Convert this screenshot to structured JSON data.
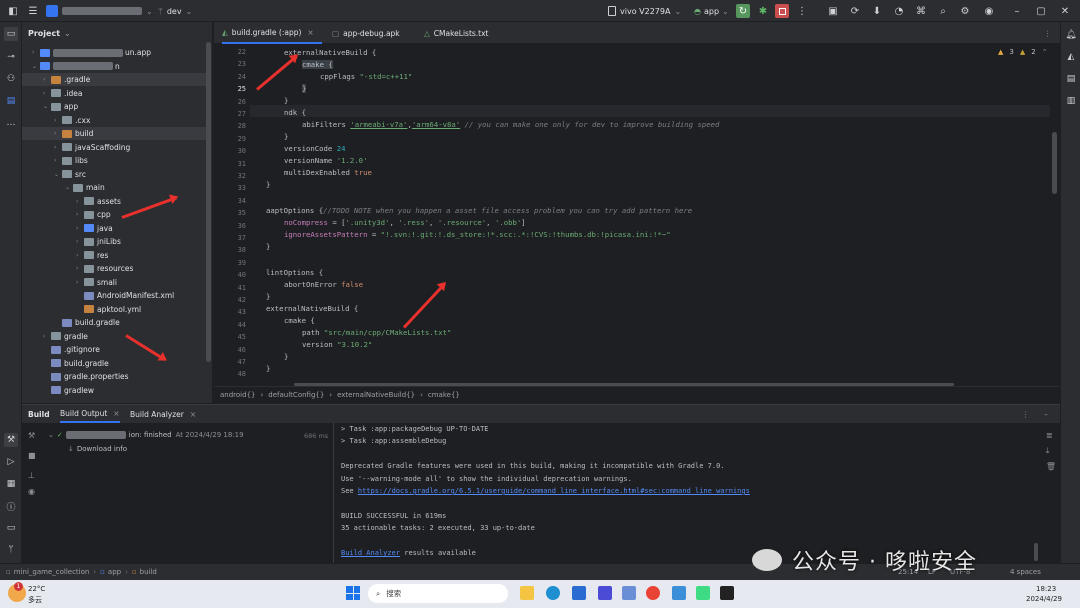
{
  "titlebar": {
    "branch": "dev",
    "device": "vivo V2279A",
    "run_config": "app"
  },
  "project_panel": {
    "header": "Project",
    "tree": [
      {
        "label": "un.app",
        "indent": 0,
        "icon": "foldb",
        "chev": "›"
      },
      {
        "label": "n",
        "indent": 0,
        "icon": "foldb",
        "chev": "⌄"
      },
      {
        "label": ".gradle",
        "indent": 1,
        "icon": "foldo",
        "chev": "›",
        "sel": true
      },
      {
        "label": ".idea",
        "indent": 1,
        "icon": "fold",
        "chev": "›"
      },
      {
        "label": "app",
        "indent": 1,
        "icon": "fold",
        "chev": "⌄"
      },
      {
        "label": ".cxx",
        "indent": 2,
        "icon": "fold",
        "chev": "›"
      },
      {
        "label": "build",
        "indent": 2,
        "icon": "foldo",
        "chev": "›",
        "sel": true
      },
      {
        "label": "javaScaffoding",
        "indent": 2,
        "icon": "fold",
        "chev": "›"
      },
      {
        "label": "libs",
        "indent": 2,
        "icon": "fold",
        "chev": "›"
      },
      {
        "label": "src",
        "indent": 2,
        "icon": "fold",
        "chev": "⌄"
      },
      {
        "label": "main",
        "indent": 3,
        "icon": "fold",
        "chev": "⌄"
      },
      {
        "label": "assets",
        "indent": 4,
        "icon": "fold",
        "chev": "›"
      },
      {
        "label": "cpp",
        "indent": 4,
        "icon": "fold",
        "chev": "›"
      },
      {
        "label": "java",
        "indent": 4,
        "icon": "foldb",
        "chev": "›"
      },
      {
        "label": "jniLibs",
        "indent": 4,
        "icon": "fold",
        "chev": "›"
      },
      {
        "label": "res",
        "indent": 4,
        "icon": "fold",
        "chev": "›"
      },
      {
        "label": "resources",
        "indent": 4,
        "icon": "fold",
        "chev": "›"
      },
      {
        "label": "smali",
        "indent": 4,
        "icon": "fold",
        "chev": "›"
      },
      {
        "label": "AndroidManifest.xml",
        "indent": 4,
        "icon": "filee",
        "chev": ""
      },
      {
        "label": "apktool.yml",
        "indent": 4,
        "icon": "foldo",
        "chev": ""
      },
      {
        "label": "build.gradle",
        "indent": 2,
        "icon": "filee",
        "chev": ""
      },
      {
        "label": "gradle",
        "indent": 1,
        "icon": "fold",
        "chev": "›"
      },
      {
        "label": ".gitignore",
        "indent": 1,
        "icon": "filee",
        "chev": ""
      },
      {
        "label": "build.gradle",
        "indent": 1,
        "icon": "filee",
        "chev": ""
      },
      {
        "label": "gradle.properties",
        "indent": 1,
        "icon": "filee",
        "chev": ""
      },
      {
        "label": "gradlew",
        "indent": 1,
        "icon": "filee",
        "chev": ""
      }
    ]
  },
  "editor": {
    "tabs": [
      "build.gradle (:app)",
      "app-debug.apk",
      "CMakeLists.txt"
    ],
    "inspections": {
      "warnings": "3",
      "weak": "2"
    },
    "line_numbers": [
      "22",
      "23",
      "24",
      "25",
      "26",
      "27",
      "28",
      "29",
      "30",
      "31",
      "32",
      "33",
      "34",
      "35",
      "36",
      "37",
      "38",
      "39",
      "40",
      "41",
      "42",
      "43",
      "44",
      "45",
      "46",
      "47",
      "48"
    ],
    "breadcrumb": [
      "android{}",
      "defaultConfig{}",
      "externalNativeBuild{}",
      "cmake{}"
    ]
  },
  "bottom": {
    "tabs": [
      "Build",
      "Build Output",
      "Build Analyzer"
    ],
    "tree": {
      "status": "ion: finished",
      "time": "At 2024/4/29 18:19",
      "duration": "686 ms",
      "child": "Download info"
    },
    "output": [
      "> Task :app:packageDebug UP-TO-DATE",
      "> Task :app:assembleDebug",
      "",
      "Deprecated Gradle features were used in this build, making it incompatible with Gradle 7.0.",
      "Use '--warning-mode all' to show the individual deprecation warnings.",
      "See ",
      "",
      "BUILD SUCCESSFUL in 619ms",
      "35 actionable tasks: 2 executed, 33 up-to-date",
      "",
      " results available"
    ],
    "output_link": "https://docs.gradle.org/6.5.1/userguide/command_line_interface.html#sec:command_line_warnings",
    "analyzer_link": "Build Analyzer"
  },
  "statusbar": {
    "path": [
      "mini_game_collection",
      "app",
      "build"
    ],
    "position": "25:14",
    "lf": "LF",
    "encoding": "UTF-8",
    "spaces": "4 spaces"
  },
  "taskbar": {
    "temp": "22°C",
    "weather": "多云",
    "search": "搜索",
    "time": "18:23",
    "date": "2024/4/29",
    "notif_count": "1"
  },
  "watermark": "公众号 · 哆啦安全"
}
